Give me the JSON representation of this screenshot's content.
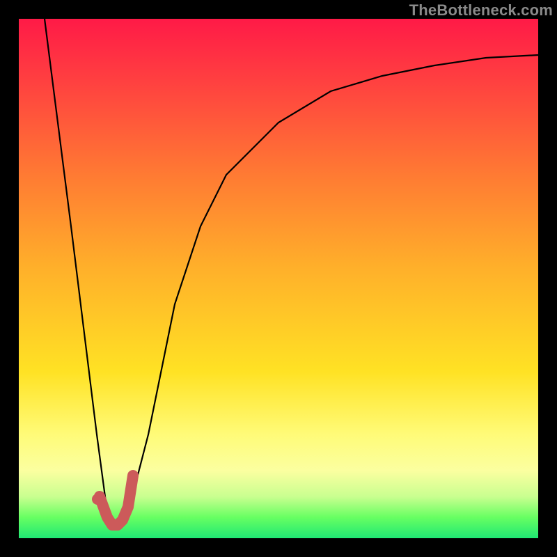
{
  "watermark_text": "TheBottleneck.com",
  "colors": {
    "frame_bg": "#000000",
    "curve": "#000000",
    "marker_stroke": "#cc5a5a",
    "marker_fill": "#cc5a5a",
    "grad_top": "#ff1a47",
    "grad_mid1": "#ff7a33",
    "grad_mid2": "#ffe224",
    "grad_mid3": "#fbffa0",
    "grad_bottom": "#1fe874"
  },
  "chart_data": {
    "type": "line",
    "title": "",
    "xlabel": "",
    "ylabel": "",
    "xlim": [
      0,
      100
    ],
    "ylim": [
      0,
      100
    ],
    "series": [
      {
        "name": "bottleneck-curve",
        "x": [
          5,
          10,
          15,
          17,
          19,
          21,
          25,
          30,
          35,
          40,
          50,
          60,
          70,
          80,
          90,
          100
        ],
        "values": [
          100,
          60,
          20,
          5,
          3,
          5,
          20,
          45,
          60,
          70,
          80,
          86,
          89,
          91,
          92.5,
          93
        ]
      }
    ],
    "optimum_marker": {
      "x": 17,
      "y": 5
    },
    "j_path": {
      "note": "salmon J-shaped check mark near optimum",
      "points_x": [
        15.5,
        17,
        18,
        19,
        20,
        21,
        22
      ],
      "points_y": [
        8,
        4,
        2.5,
        2.5,
        3.5,
        6,
        12
      ]
    }
  }
}
